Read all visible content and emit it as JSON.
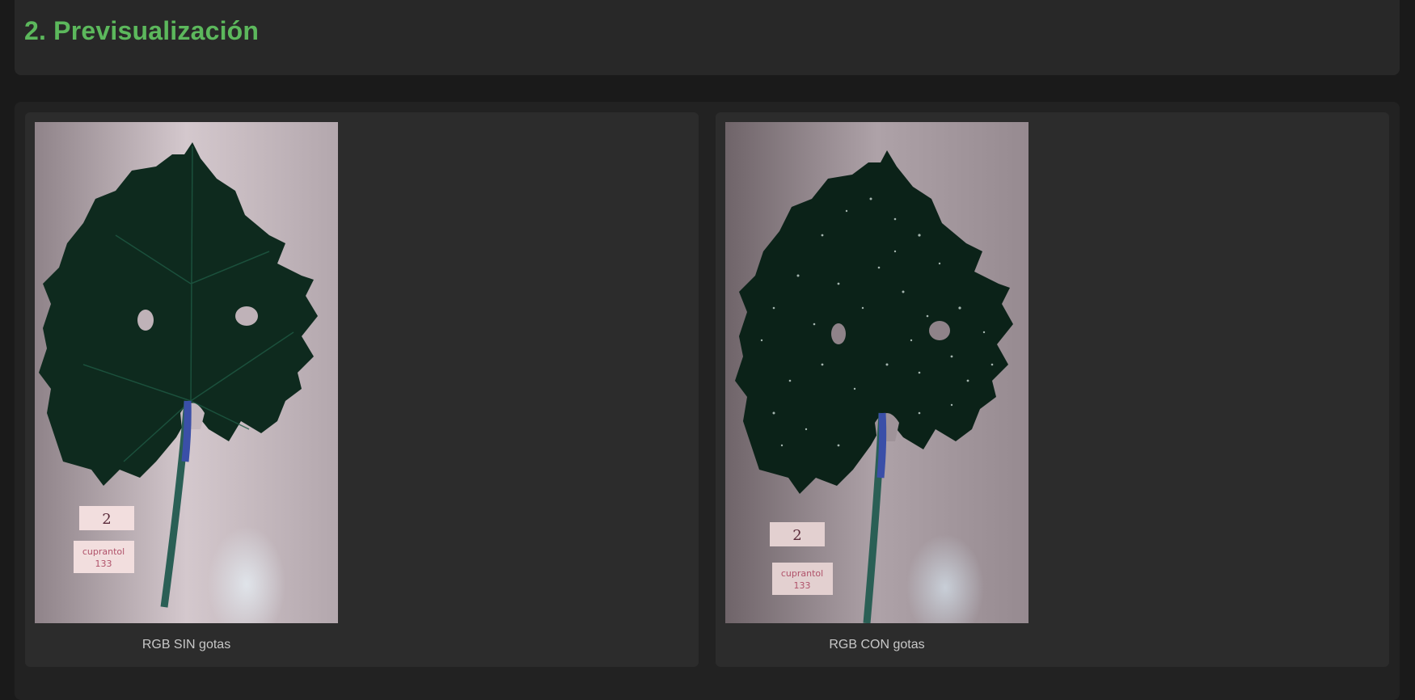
{
  "section": {
    "title": "2. Previsualización"
  },
  "previews": [
    {
      "caption": "RGB SIN gotas",
      "label_number": "2",
      "label_text_line1": "cuprantol",
      "label_text_line2": "133"
    },
    {
      "caption": "RGB CON gotas",
      "label_number": "2",
      "label_text_line1": "cuprantol",
      "label_text_line2": "133"
    }
  ],
  "colors": {
    "title_green": "#5cb85c",
    "leaf_dark_green": "#0e2a1e",
    "stem_blue": "#3a4fa8",
    "background_paper": "#c9bcc2"
  }
}
